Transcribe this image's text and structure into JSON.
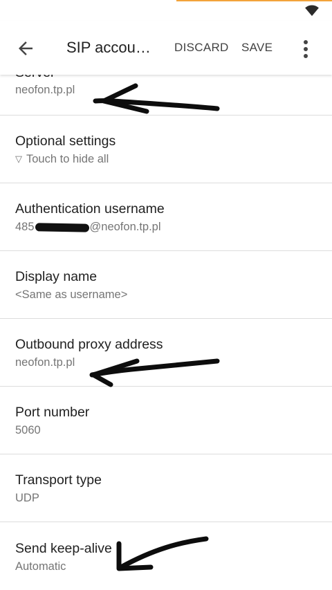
{
  "appbar": {
    "title": "SIP accou…",
    "discard_label": "DISCARD",
    "save_label": "SAVE"
  },
  "preferences": [
    {
      "title": "Server",
      "summary": "neofon.tp.pl"
    },
    {
      "title": "Optional settings",
      "summary_icon": "▽",
      "summary": "Touch to hide all"
    },
    {
      "title": "Authentication username",
      "summary_prefix": "485",
      "summary_suffix": "@neofon.tp.pl",
      "summary_redacted": true
    },
    {
      "title": "Display name",
      "summary": "<Same as username>"
    },
    {
      "title": "Outbound proxy address",
      "summary": "neofon.tp.pl"
    },
    {
      "title": "Port number",
      "summary": "5060"
    },
    {
      "title": "Transport type",
      "summary": "UDP"
    },
    {
      "title": "Send keep-alive",
      "summary": "Automatic"
    }
  ],
  "colors": {
    "status_accent": "#f3a33a",
    "title_text": "#212121",
    "summary_text": "#757575",
    "divider": "#dcdcdc"
  },
  "icons": [
    "wifi-icon",
    "back-arrow-icon",
    "more-vert-icon"
  ]
}
